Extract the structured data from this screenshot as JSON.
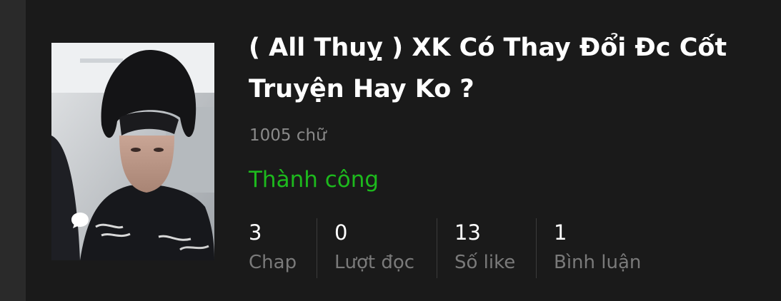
{
  "story": {
    "title": "( All Thuỵ ) XK Có Thay Đổi Đc Cốt Truyện Hay Ko ?",
    "word_count": "1005 chữ",
    "status": "Thành công",
    "cover_icon": "comment-bubble-icon"
  },
  "stats": [
    {
      "value": "3",
      "label": "Chap"
    },
    {
      "value": "0",
      "label": "Lượt đọc"
    },
    {
      "value": "13",
      "label": "Số like"
    },
    {
      "value": "1",
      "label": "Bình luận"
    }
  ],
  "colors": {
    "background": "#1a1a1a",
    "status_green": "#1db91d",
    "title": "#ffffff",
    "muted": "#8a8a8a"
  }
}
